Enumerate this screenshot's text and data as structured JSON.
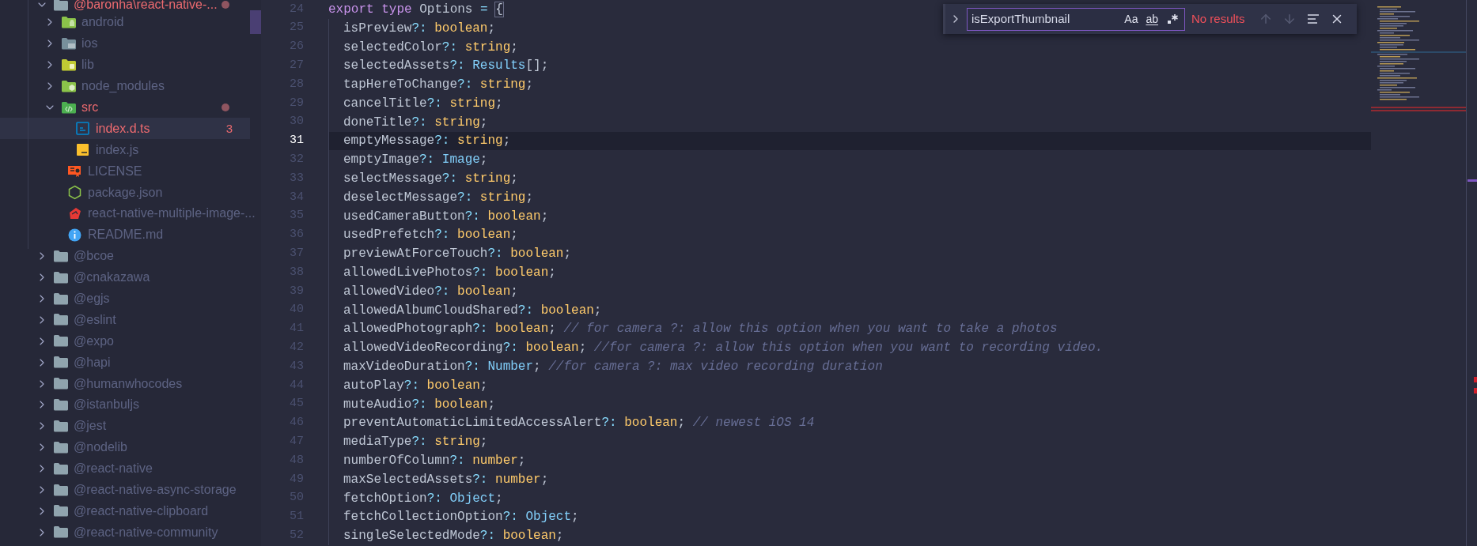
{
  "explorer": {
    "items": [
      {
        "label": "@baronha\\react-native-...",
        "kind": "folder",
        "expanded": true,
        "selected": false,
        "error": true,
        "dot": true,
        "children": [
          {
            "label": "android",
            "kind": "android",
            "expanded": false,
            "selected": false,
            "error": false,
            "dot": false
          },
          {
            "label": "ios",
            "kind": "ios",
            "expanded": false,
            "selected": false,
            "error": false,
            "dot": false
          },
          {
            "label": "lib",
            "kind": "lib",
            "expanded": false,
            "selected": false,
            "error": false,
            "dot": false
          },
          {
            "label": "node_modules",
            "kind": "nodemodules",
            "expanded": false,
            "selected": false,
            "error": false,
            "dot": false
          },
          {
            "label": "src",
            "kind": "source",
            "expanded": true,
            "selected": false,
            "error": true,
            "dot": true,
            "children": [
              {
                "label": "index.d.ts",
                "kind": "typescript",
                "selected": true,
                "error": true,
                "dot": false,
                "badge": "3"
              },
              {
                "label": "index.js",
                "kind": "javascript",
                "selected": false,
                "error": false,
                "dot": false
              }
            ]
          },
          {
            "label": "LICENSE",
            "kind": "license",
            "selected": false,
            "error": false,
            "dot": false
          },
          {
            "label": "package.json",
            "kind": "nodejs",
            "selected": false,
            "error": false,
            "dot": false
          },
          {
            "label": "react-native-multiple-image-...",
            "kind": "podspec",
            "selected": false,
            "error": false,
            "dot": false
          },
          {
            "label": "README.md",
            "kind": "info",
            "selected": false,
            "error": false,
            "dot": false
          }
        ]
      },
      {
        "label": "@bcoe",
        "kind": "folder",
        "expanded": false,
        "selected": false,
        "error": false,
        "dot": false
      },
      {
        "label": "@cnakazawa",
        "kind": "folder",
        "expanded": false,
        "selected": false,
        "error": false,
        "dot": false
      },
      {
        "label": "@egjs",
        "kind": "folder",
        "expanded": false,
        "selected": false,
        "error": false,
        "dot": false
      },
      {
        "label": "@eslint",
        "kind": "folder",
        "expanded": false,
        "selected": false,
        "error": false,
        "dot": false
      },
      {
        "label": "@expo",
        "kind": "folder",
        "expanded": false,
        "selected": false,
        "error": false,
        "dot": false
      },
      {
        "label": "@hapi",
        "kind": "folder",
        "expanded": false,
        "selected": false,
        "error": false,
        "dot": false
      },
      {
        "label": "@humanwhocodes",
        "kind": "folder",
        "expanded": false,
        "selected": false,
        "error": false,
        "dot": false
      },
      {
        "label": "@istanbuljs",
        "kind": "folder",
        "expanded": false,
        "selected": false,
        "error": false,
        "dot": false
      },
      {
        "label": "@jest",
        "kind": "folder",
        "expanded": false,
        "selected": false,
        "error": false,
        "dot": false
      },
      {
        "label": "@nodelib",
        "kind": "folder",
        "expanded": false,
        "selected": false,
        "error": false,
        "dot": false
      },
      {
        "label": "@react-native",
        "kind": "folder",
        "expanded": false,
        "selected": false,
        "error": false,
        "dot": false
      },
      {
        "label": "@react-native-async-storage",
        "kind": "folder",
        "expanded": false,
        "selected": false,
        "error": false,
        "dot": false
      },
      {
        "label": "@react-native-clipboard",
        "kind": "folder",
        "expanded": false,
        "selected": false,
        "error": false,
        "dot": false
      },
      {
        "label": "@react-native-community",
        "kind": "folder",
        "expanded": false,
        "selected": false,
        "error": false,
        "dot": false
      }
    ]
  },
  "editor": {
    "lines": [
      {
        "number": "24",
        "current": false,
        "tokens": [
          {
            "text": "export",
            "kind": "kw"
          },
          {
            "text": " type",
            "kind": "kw"
          },
          {
            "text": " Options",
            "kind": "prop"
          },
          {
            "text": " = ",
            "kind": "op"
          },
          {
            "text": "{",
            "kind": "bracket"
          }
        ],
        "children": [
          {
            "number": "25",
            "current": false,
            "tokens": [
              {
                "text": "isPreview",
                "kind": "prop"
              },
              {
                "text": "?:",
                "kind": "op"
              },
              {
                "text": " boolean",
                "kind": "type"
              },
              {
                "text": ";",
                "kind": "punct"
              }
            ]
          },
          {
            "number": "26",
            "current": false,
            "tokens": [
              {
                "text": "selectedColor",
                "kind": "prop"
              },
              {
                "text": "?:",
                "kind": "op"
              },
              {
                "text": " string",
                "kind": "type"
              },
              {
                "text": ";",
                "kind": "punct"
              }
            ]
          },
          {
            "number": "27",
            "current": false,
            "tokens": [
              {
                "text": "selectedAssets",
                "kind": "prop"
              },
              {
                "text": "?:",
                "kind": "op"
              },
              {
                "text": " Results",
                "kind": "cls"
              },
              {
                "text": "[];",
                "kind": "punct"
              }
            ]
          },
          {
            "number": "28",
            "current": false,
            "tokens": [
              {
                "text": "tapHereToChange",
                "kind": "prop"
              },
              {
                "text": "?:",
                "kind": "op"
              },
              {
                "text": " string",
                "kind": "type"
              },
              {
                "text": ";",
                "kind": "punct"
              }
            ]
          },
          {
            "number": "29",
            "current": false,
            "tokens": [
              {
                "text": "cancelTitle",
                "kind": "prop"
              },
              {
                "text": "?:",
                "kind": "op"
              },
              {
                "text": " string",
                "kind": "type"
              },
              {
                "text": ";",
                "kind": "punct"
              }
            ]
          },
          {
            "number": "30",
            "current": false,
            "tokens": [
              {
                "text": "doneTitle",
                "kind": "prop"
              },
              {
                "text": "?:",
                "kind": "op"
              },
              {
                "text": " string",
                "kind": "type"
              },
              {
                "text": ";",
                "kind": "punct"
              }
            ]
          },
          {
            "number": "31",
            "current": true,
            "tokens": [
              {
                "text": "emptyMessage",
                "kind": "prop"
              },
              {
                "text": "?:",
                "kind": "op"
              },
              {
                "text": " string",
                "kind": "type"
              },
              {
                "text": ";",
                "kind": "punct"
              }
            ]
          },
          {
            "number": "32",
            "current": false,
            "tokens": [
              {
                "text": "emptyImage",
                "kind": "prop"
              },
              {
                "text": "?:",
                "kind": "op"
              },
              {
                "text": " Image",
                "kind": "cls"
              },
              {
                "text": ";",
                "kind": "punct"
              }
            ]
          },
          {
            "number": "33",
            "current": false,
            "tokens": [
              {
                "text": "selectMessage",
                "kind": "prop"
              },
              {
                "text": "?:",
                "kind": "op"
              },
              {
                "text": " string",
                "kind": "type"
              },
              {
                "text": ";",
                "kind": "punct"
              }
            ]
          },
          {
            "number": "34",
            "current": false,
            "tokens": [
              {
                "text": "deselectMessage",
                "kind": "prop"
              },
              {
                "text": "?:",
                "kind": "op"
              },
              {
                "text": " string",
                "kind": "type"
              },
              {
                "text": ";",
                "kind": "punct"
              }
            ]
          },
          {
            "number": "35",
            "current": false,
            "tokens": [
              {
                "text": "usedCameraButton",
                "kind": "prop"
              },
              {
                "text": "?:",
                "kind": "op"
              },
              {
                "text": " boolean",
                "kind": "type"
              },
              {
                "text": ";",
                "kind": "punct"
              }
            ]
          },
          {
            "number": "36",
            "current": false,
            "tokens": [
              {
                "text": "usedPrefetch",
                "kind": "prop"
              },
              {
                "text": "?:",
                "kind": "op"
              },
              {
                "text": " boolean",
                "kind": "type"
              },
              {
                "text": ";",
                "kind": "punct"
              }
            ]
          },
          {
            "number": "37",
            "current": false,
            "tokens": [
              {
                "text": "previewAtForceTouch",
                "kind": "prop"
              },
              {
                "text": "?:",
                "kind": "op"
              },
              {
                "text": " boolean",
                "kind": "type"
              },
              {
                "text": ";",
                "kind": "punct"
              }
            ]
          },
          {
            "number": "38",
            "current": false,
            "tokens": [
              {
                "text": "allowedLivePhotos",
                "kind": "prop"
              },
              {
                "text": "?:",
                "kind": "op"
              },
              {
                "text": " boolean",
                "kind": "type"
              },
              {
                "text": ";",
                "kind": "punct"
              }
            ]
          },
          {
            "number": "39",
            "current": false,
            "tokens": [
              {
                "text": "allowedVideo",
                "kind": "prop"
              },
              {
                "text": "?:",
                "kind": "op"
              },
              {
                "text": " boolean",
                "kind": "type"
              },
              {
                "text": ";",
                "kind": "punct"
              }
            ]
          },
          {
            "number": "40",
            "current": false,
            "tokens": [
              {
                "text": "allowedAlbumCloudShared",
                "kind": "prop"
              },
              {
                "text": "?:",
                "kind": "op"
              },
              {
                "text": " boolean",
                "kind": "type"
              },
              {
                "text": ";",
                "kind": "punct"
              }
            ]
          },
          {
            "number": "41",
            "current": false,
            "tokens": [
              {
                "text": "allowedPhotograph",
                "kind": "prop"
              },
              {
                "text": "?:",
                "kind": "op"
              },
              {
                "text": " boolean",
                "kind": "type"
              },
              {
                "text": ";",
                "kind": "punct"
              },
              {
                "text": " // for camera ?: allow this option when you want to take a photos",
                "kind": "comment"
              }
            ]
          },
          {
            "number": "42",
            "current": false,
            "tokens": [
              {
                "text": "allowedVideoRecording",
                "kind": "prop"
              },
              {
                "text": "?:",
                "kind": "op"
              },
              {
                "text": " boolean",
                "kind": "type"
              },
              {
                "text": ";",
                "kind": "punct"
              },
              {
                "text": " //for camera ?: allow this option when you want to recording video.",
                "kind": "comment"
              }
            ]
          },
          {
            "number": "43",
            "current": false,
            "tokens": [
              {
                "text": "maxVideoDuration",
                "kind": "prop"
              },
              {
                "text": "?:",
                "kind": "op"
              },
              {
                "text": " Number",
                "kind": "cls"
              },
              {
                "text": ";",
                "kind": "punct"
              },
              {
                "text": " //for camera ?: max video recording duration",
                "kind": "comment"
              }
            ]
          },
          {
            "number": "44",
            "current": false,
            "tokens": [
              {
                "text": "autoPlay",
                "kind": "prop"
              },
              {
                "text": "?:",
                "kind": "op"
              },
              {
                "text": " boolean",
                "kind": "type"
              },
              {
                "text": ";",
                "kind": "punct"
              }
            ]
          },
          {
            "number": "45",
            "current": false,
            "tokens": [
              {
                "text": "muteAudio",
                "kind": "prop"
              },
              {
                "text": "?:",
                "kind": "op"
              },
              {
                "text": " boolean",
                "kind": "type"
              },
              {
                "text": ";",
                "kind": "punct"
              }
            ]
          },
          {
            "number": "46",
            "current": false,
            "tokens": [
              {
                "text": "preventAutomaticLimitedAccessAlert",
                "kind": "prop"
              },
              {
                "text": "?:",
                "kind": "op"
              },
              {
                "text": " boolean",
                "kind": "type"
              },
              {
                "text": ";",
                "kind": "punct"
              },
              {
                "text": " // newest iOS 14",
                "kind": "comment"
              }
            ]
          },
          {
            "number": "47",
            "current": false,
            "tokens": [
              {
                "text": "mediaType",
                "kind": "prop"
              },
              {
                "text": "?:",
                "kind": "op"
              },
              {
                "text": " string",
                "kind": "type"
              },
              {
                "text": ";",
                "kind": "punct"
              }
            ]
          },
          {
            "number": "48",
            "current": false,
            "tokens": [
              {
                "text": "numberOfColumn",
                "kind": "prop"
              },
              {
                "text": "?:",
                "kind": "op"
              },
              {
                "text": " number",
                "kind": "type"
              },
              {
                "text": ";",
                "kind": "punct"
              }
            ]
          },
          {
            "number": "49",
            "current": false,
            "tokens": [
              {
                "text": "maxSelectedAssets",
                "kind": "prop"
              },
              {
                "text": "?:",
                "kind": "op"
              },
              {
                "text": " number",
                "kind": "type"
              },
              {
                "text": ";",
                "kind": "punct"
              }
            ]
          },
          {
            "number": "50",
            "current": false,
            "tokens": [
              {
                "text": "fetchOption",
                "kind": "prop"
              },
              {
                "text": "?:",
                "kind": "op"
              },
              {
                "text": " Object",
                "kind": "cls"
              },
              {
                "text": ";",
                "kind": "punct"
              }
            ]
          },
          {
            "number": "51",
            "current": false,
            "tokens": [
              {
                "text": "fetchCollectionOption",
                "kind": "prop"
              },
              {
                "text": "?:",
                "kind": "op"
              },
              {
                "text": " Object",
                "kind": "cls"
              },
              {
                "text": ";",
                "kind": "punct"
              }
            ]
          },
          {
            "number": "52",
            "current": false,
            "tokens": [
              {
                "text": "singleSelectedMode",
                "kind": "prop"
              },
              {
                "text": "?:",
                "kind": "op"
              },
              {
                "text": " boolean",
                "kind": "type"
              },
              {
                "text": ";",
                "kind": "punct"
              }
            ]
          }
        ]
      }
    ]
  },
  "find": {
    "expanded": false,
    "value": "isExportThumbnail",
    "toggles": [
      {
        "kind": "case",
        "label": "Aa",
        "selected": false
      },
      {
        "kind": "word",
        "label": "ab",
        "selected": false
      },
      {
        "kind": "regex",
        "selected": false
      }
    ],
    "status": "No results",
    "error": true,
    "buttons": [
      {
        "kind": "previous",
        "disabled": true
      },
      {
        "kind": "next",
        "disabled": true
      },
      {
        "kind": "selection",
        "disabled": false
      },
      {
        "kind": "close",
        "disabled": false
      }
    ]
  }
}
